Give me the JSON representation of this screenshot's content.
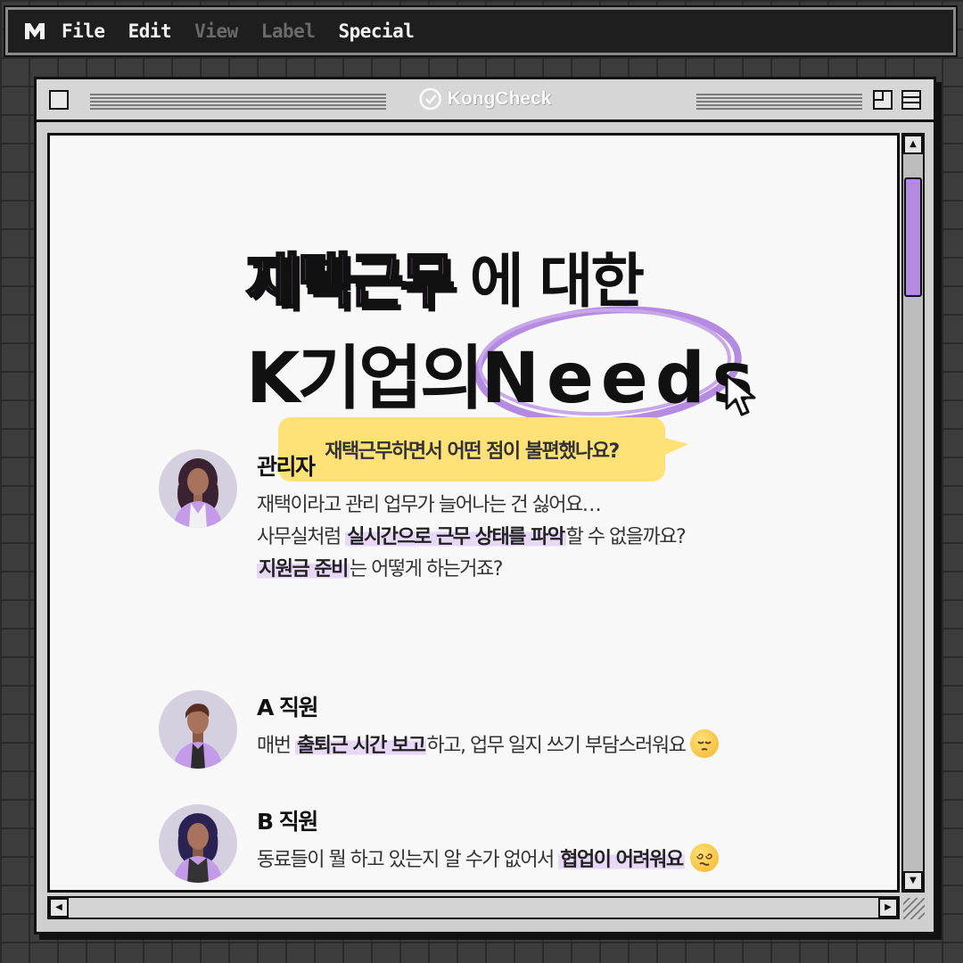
{
  "menubar": {
    "logo": "M",
    "items": [
      {
        "label": "File",
        "enabled": true
      },
      {
        "label": "Edit",
        "enabled": true
      },
      {
        "label": "View",
        "enabled": false
      },
      {
        "label": "Label",
        "enabled": false
      },
      {
        "label": "Special",
        "enabled": true
      }
    ]
  },
  "window": {
    "title": "KongCheck"
  },
  "headline": {
    "line1_accent": "재택근무",
    "line1_rest": "에 대한",
    "line2_prefix": "K기업의",
    "line2_highlight": "Needs"
  },
  "question": "재택근무하면서 어떤 점이 불편했나요?",
  "people": [
    {
      "role": "관리자",
      "line1": "재택이라고 관리 업무가 늘어나는 건 싫어요…",
      "line2_pre": "사무실처럼 ",
      "line2_hl": "실시간으로 근무 상태를 파악",
      "line2_post": "할 수 없을까요?",
      "line3_hl": "지원금 준비",
      "line3_post": "는 어떻게 하는거죠?"
    },
    {
      "role": "A 직원",
      "line1_pre": "매번 ",
      "line1_hl": "출퇴근 시간 보고",
      "line1_post": "하고, 업무 일지 쓰기 부담스러워요",
      "emoji": "pensive-face"
    },
    {
      "role": "B 직원",
      "line1_pre": "동료들이 뭘 하고 있는지 알 수가 없어서 ",
      "line1_hl": "협업이 어려워요",
      "emoji": "dizzy-face"
    }
  ],
  "colors": {
    "accent_purple": "#c49be9",
    "bubble_yellow": "#ffe277",
    "highlight_lavender": "#e8d8f7"
  }
}
